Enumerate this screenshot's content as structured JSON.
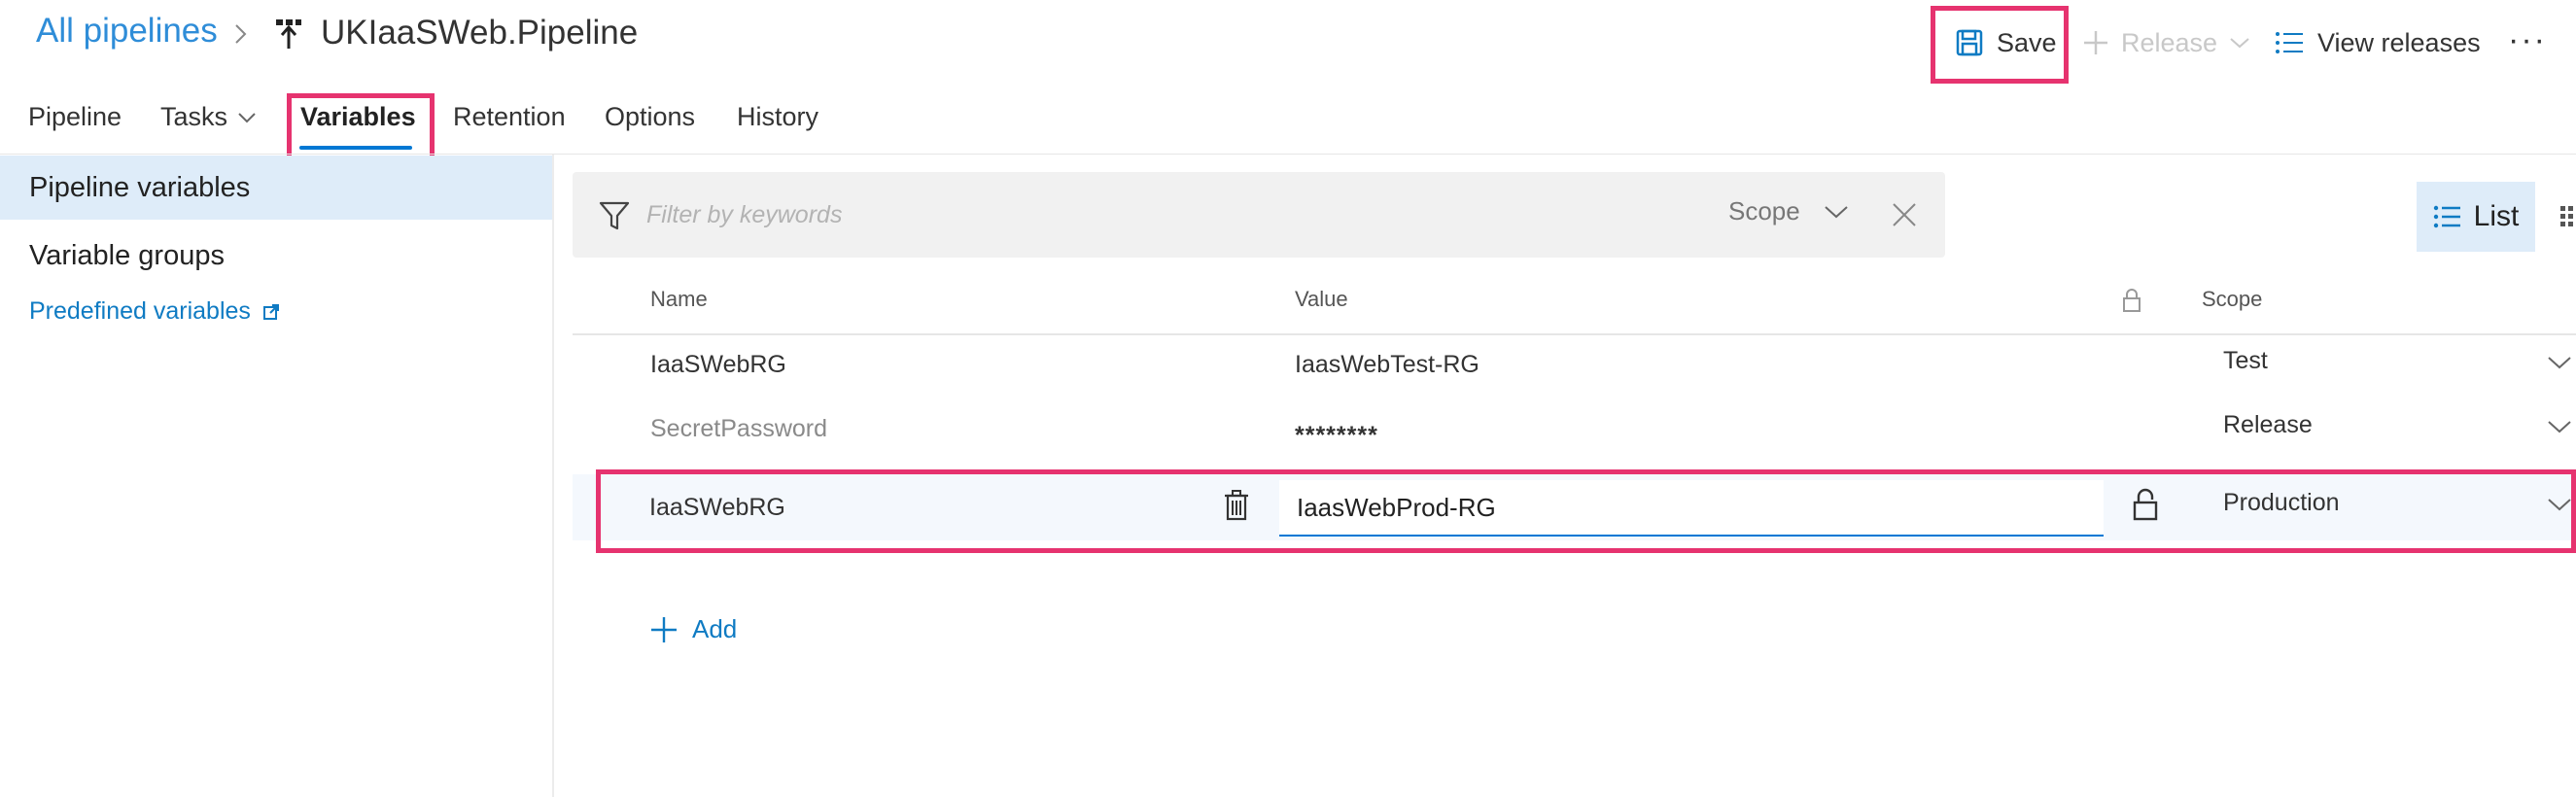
{
  "header": {
    "breadcrumb": "All pipelines",
    "pipeline_name": "UKIaaSWeb.Pipeline",
    "save_label": "Save",
    "release_label": "Release",
    "view_releases_label": "View releases",
    "more_label": "···"
  },
  "tabs": [
    {
      "label": "Pipeline"
    },
    {
      "label": "Tasks"
    },
    {
      "label": "Variables"
    },
    {
      "label": "Retention"
    },
    {
      "label": "Options"
    },
    {
      "label": "History"
    }
  ],
  "sidebar": {
    "items": [
      {
        "label": "Pipeline variables"
      },
      {
        "label": "Variable groups"
      }
    ],
    "predefined_label": "Predefined variables"
  },
  "filter": {
    "placeholder": "Filter by keywords",
    "scope_label": "Scope"
  },
  "view": {
    "list_label": "List"
  },
  "table": {
    "headers": {
      "name": "Name",
      "value": "Value",
      "scope": "Scope"
    },
    "rows": [
      {
        "name": "IaaSWebRG",
        "value": "IaasWebTest-RG",
        "scope": "Test"
      },
      {
        "name": "SecretPassword",
        "value": "********",
        "scope": "Release"
      },
      {
        "name": "IaaSWebRG",
        "value": "IaasWebProd-RG",
        "scope": "Production"
      }
    ]
  },
  "add_label": "Add",
  "colors": {
    "accent": "#0078d4",
    "link": "#2f8dd8",
    "highlight": "#e6336f",
    "selected_bg": "#deecf9"
  }
}
